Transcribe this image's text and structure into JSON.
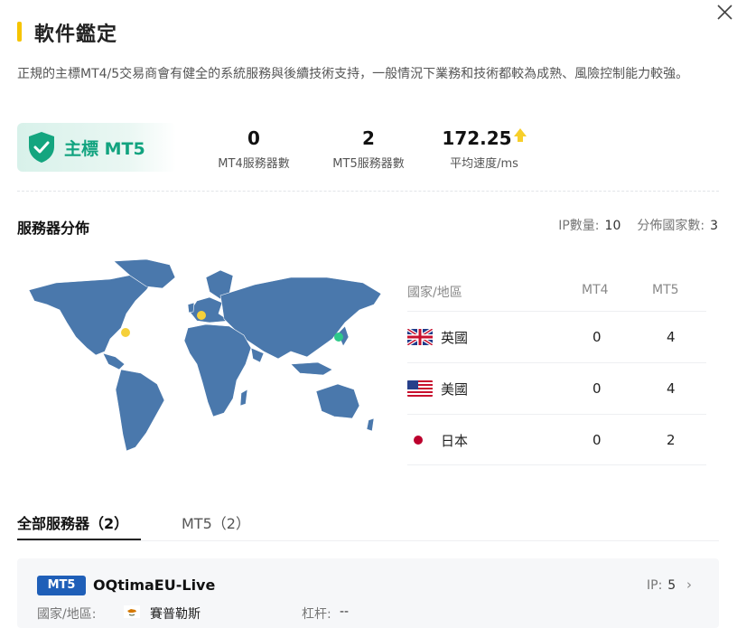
{
  "header": {
    "title": "軟件鑑定"
  },
  "description": "正規的主標MT4/5交易商會有健全的系統服務與後續技術支持，一般情況下業務和技術都較為成熟、風險控制能力較強。",
  "badge": {
    "label": "主標 MT5",
    "color": "#11a37f"
  },
  "stats": {
    "mt4_count": "0",
    "mt4_label": "MT4服務器數",
    "mt5_count": "2",
    "mt5_label": "MT5服務器數",
    "speed": "172.25",
    "speed_label": "平均速度/ms"
  },
  "distribution": {
    "title": "服務器分佈",
    "ip_label": "IP數量:",
    "ip_value": "10",
    "country_label": "分佈國家數:",
    "country_value": "3"
  },
  "table": {
    "headers": {
      "country": "國家/地區",
      "mt4": "MT4",
      "mt5": "MT5"
    },
    "rows": [
      {
        "country": "英國",
        "mt4": "0",
        "mt5": "4",
        "flag": "uk-flag"
      },
      {
        "country": "美國",
        "mt4": "0",
        "mt5": "4",
        "flag": "us-flag"
      },
      {
        "country": "日本",
        "mt4": "0",
        "mt5": "2",
        "flag": "japan-flag"
      }
    ]
  },
  "tabs": {
    "all": "全部服務器（2）",
    "mt5": "MT5（2）"
  },
  "server_card": {
    "tag": "MT5",
    "name": "OQtimaEU-Live",
    "ip_label": "IP:",
    "ip_value": "5",
    "country_label": "國家/地區:",
    "country_value": "賽普勒斯",
    "leverage_label": "杠杆:",
    "leverage_value": "--"
  },
  "colors": {
    "accent_yellow": "#f6c400",
    "map_blue": "#4a78ac",
    "tag_blue": "#1f5fb8",
    "dot_yellow": "#f5d03a",
    "dot_green": "#2ec98a"
  }
}
